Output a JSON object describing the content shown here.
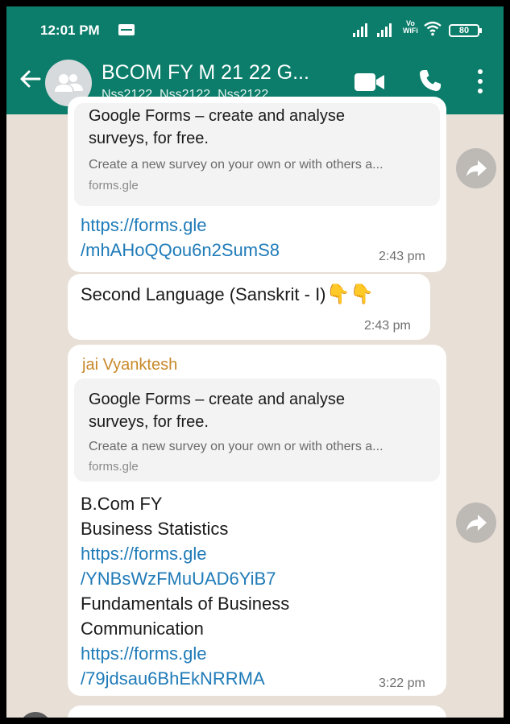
{
  "status_bar": {
    "time": "12:01 PM",
    "volte_top": "Vo",
    "volte_bottom": "WiFi",
    "battery": "80"
  },
  "header": {
    "title": "BCOM FY M 21 22 G...",
    "subtitle": "Nss2122, Nss2122, Nss2122,..."
  },
  "messages": [
    {
      "preview_title_line1": "Google Forms – create and analyse",
      "preview_title_line2": "surveys, for free.",
      "preview_desc": "Create a new survey on your own or with others a...",
      "preview_domain": "forms.gle",
      "link_line1": "https://forms.gle",
      "link_line2": "/mhAHoQQou6n2SumS8",
      "time": "2:43 pm"
    },
    {
      "text": "Second Language (Sanskrit - I)",
      "emoji": "👇👇",
      "time": "2:43 pm"
    },
    {
      "sender": "jai Vyanktesh",
      "preview_title_line1": "Google Forms – create and analyse",
      "preview_title_line2": "surveys, for free.",
      "preview_desc": "Create a new survey on your own or with others a...",
      "preview_domain": "forms.gle",
      "line1": "B.Com FY",
      "line2": "Business Statistics",
      "link1_line1": "https://forms.gle",
      "link1_line2": "/YNBsWzFMuUAD6YiB7",
      "line3": "Fundamentals of Business",
      "line4": "Communication",
      "link2_line1": "https://forms.gle",
      "link2_line2": "/79jdsau6BhEkNRRMA",
      "time": "3:22 pm"
    }
  ],
  "icons": {
    "back": "arrow-left-icon",
    "avatar": "group-avatar-icon",
    "video": "video-call-icon",
    "call": "phone-icon",
    "menu": "more-vertical-icon",
    "forward": "forward-icon"
  },
  "colors": {
    "header": "#0b7d6a",
    "chat_bg": "#e8dfd6",
    "link": "#1f7bb8",
    "sender": "#c8892a"
  }
}
